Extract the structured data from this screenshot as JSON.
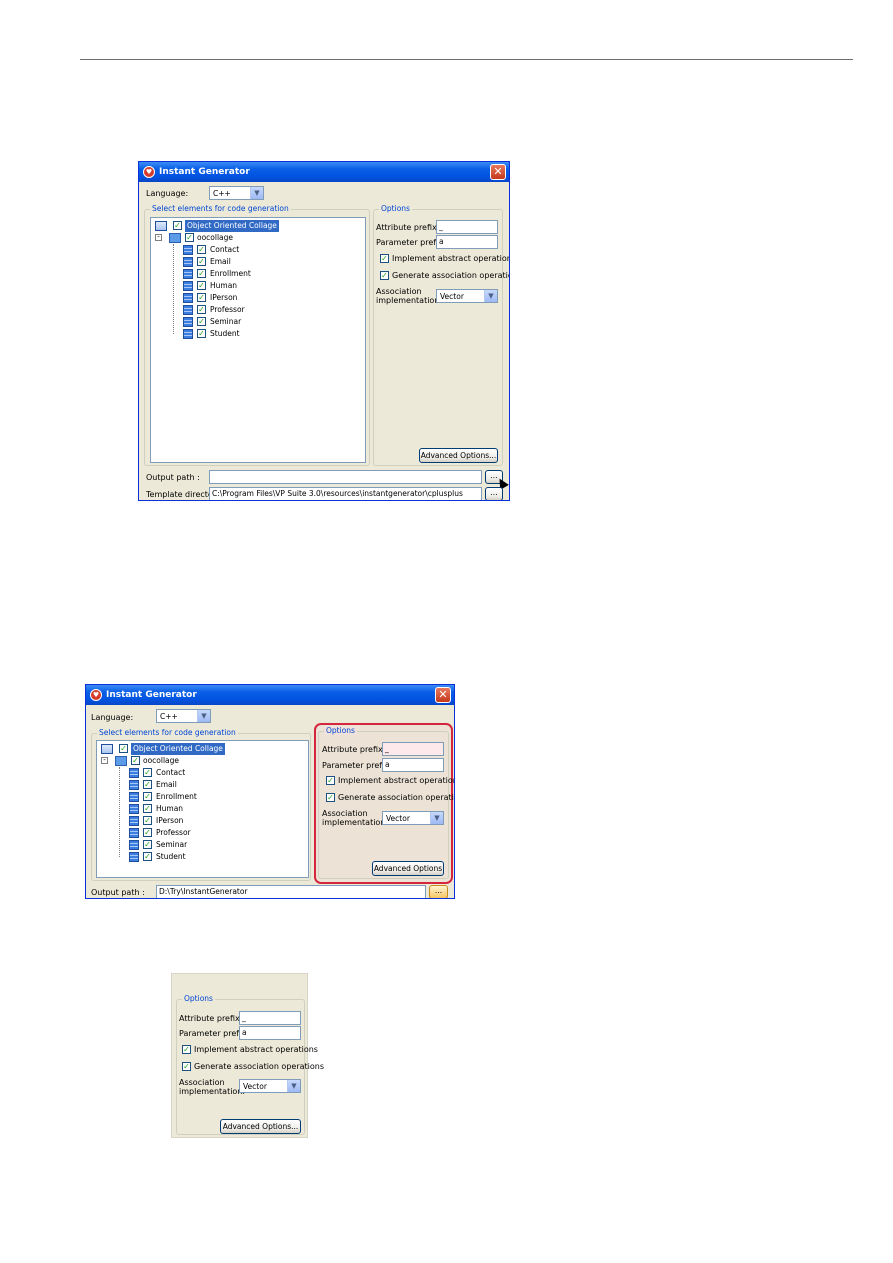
{
  "dialog": {
    "title": "Instant Generator",
    "language_label": "Language:",
    "language_value": "C++",
    "select_legend": "Select elements for code generation",
    "output_label": "Output path :",
    "template_label": "Template directory:",
    "browse_label": "...",
    "close_label": "✕"
  },
  "tree": {
    "root": "Object Oriented Collage",
    "package": "oocollage",
    "classes": [
      "Contact",
      "Email",
      "Enrollment",
      "Human",
      "IPerson",
      "Professor",
      "Seminar",
      "Student"
    ]
  },
  "options": {
    "legend": "Options",
    "attribute_prefix_label": "Attribute prefix:",
    "attribute_prefix_value": "_",
    "parameter_prefix_label": "Parameter prefix:",
    "parameter_prefix_value": "a",
    "implement_abstract_label": "Implement abstract operations",
    "generate_association_label": "Generate association operations",
    "association_impl_label_1": "Association",
    "association_impl_label_2": "implementation:",
    "association_impl_value": "Vector",
    "advanced_label": "Advanced Options...",
    "advanced_label_short": "Advanced Options"
  },
  "screenshot1": {
    "output_path": "",
    "template_dir": "C:\\Program Files\\VP Suite 3.0\\resources\\instantgenerator\\cplusplus"
  },
  "screenshot2": {
    "output_path": "D:\\Try\\InstantGenerator"
  }
}
